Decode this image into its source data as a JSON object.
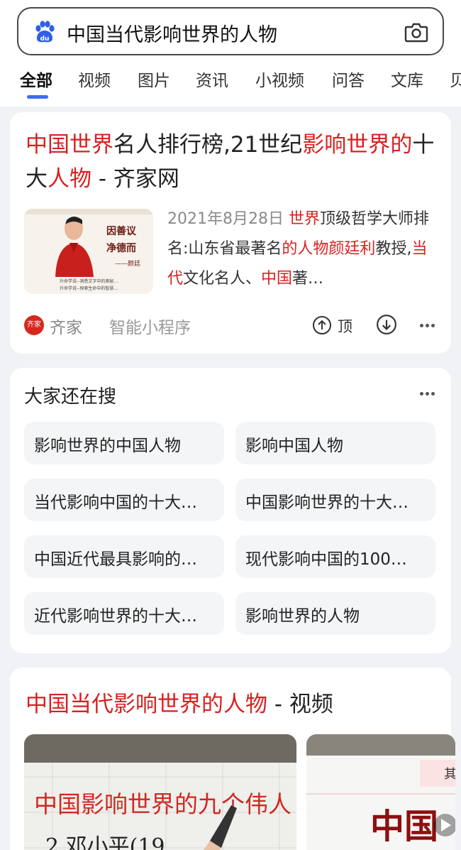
{
  "search": {
    "query": "中国当代影响世界的人物",
    "logo_icon": "baidu-paw-icon",
    "camera_icon": "camera-icon"
  },
  "tabs": [
    {
      "label": "全部",
      "active": true
    },
    {
      "label": "视频"
    },
    {
      "label": "图片"
    },
    {
      "label": "资讯"
    },
    {
      "label": "小视频"
    },
    {
      "label": "问答"
    },
    {
      "label": "文库"
    },
    {
      "label": "贝"
    }
  ],
  "result1": {
    "title_parts": [
      {
        "text": "中国世界",
        "hl": true
      },
      {
        "text": "名人排行榜,21世纪",
        "hl": false
      },
      {
        "text": "影响世界",
        "hl": true
      },
      {
        "text": "的",
        "hl": true
      },
      {
        "text": "十大",
        "hl": false
      },
      {
        "text": "人物",
        "hl": true
      },
      {
        "text": " - 齐家网",
        "hl": false
      }
    ],
    "date": "2021年8月28日",
    "snippet_parts": [
      {
        "text": "世界",
        "hl": true
      },
      {
        "text": "顶级哲学大师排名:山东省最著名",
        "hl": false
      },
      {
        "text": "的人物颜廷利",
        "hl": true
      },
      {
        "text": "教授,",
        "hl": false
      },
      {
        "text": "当代",
        "hl": true
      },
      {
        "text": "文化名人、",
        "hl": false
      },
      {
        "text": "中国",
        "hl": true
      },
      {
        "text": "著…",
        "hl": false
      }
    ],
    "thumb_text": {
      "line1": "因善议",
      "line2": "净德而",
      "line3": "——颜廷",
      "cap1": "升命学说--洞悉文字中的奥秘…",
      "cap2": "升命学说--探索生命中的智慧…"
    },
    "source_logo_text": "齐家",
    "source_name": "齐家",
    "source_tag": "智能小程序",
    "vote_up_label": "顶"
  },
  "related": {
    "title": "大家还在搜",
    "items": [
      "影响世界的中国人物",
      "影响中国人物",
      "当代影响中国的十大…",
      "中国影响世界的十大…",
      "中国近代最具影响的…",
      "现代影响中国的100…",
      "近代影响世界的十大…",
      "影响世界的人物"
    ]
  },
  "video_section": {
    "title_hl": "中国当代影响世界的人物",
    "title_rest": " - 视频",
    "thumb1_text": "中国影响世界的九个伟人",
    "thumb1_line2": "2.邓小平(19",
    "thumb2_text": "中国",
    "thumb2_corner": "其"
  },
  "colors": {
    "highlight": "#d92020",
    "accent": "#3b6cf6",
    "background": "#f1f2f5"
  }
}
